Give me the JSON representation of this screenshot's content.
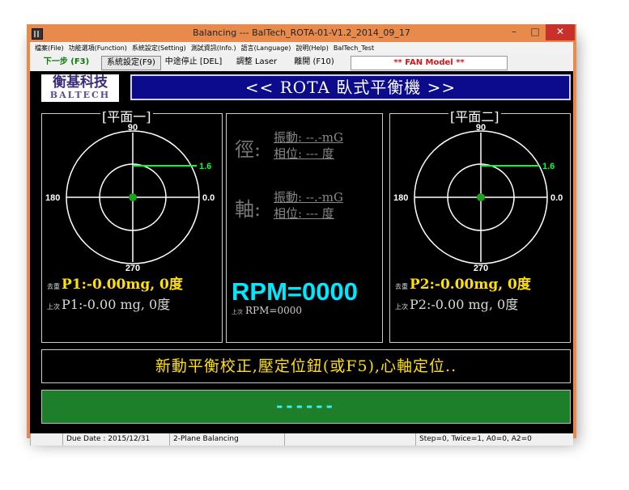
{
  "window": {
    "title": "Balancing --- BalTech_ROTA-01-V1.2_2014_09_17",
    "min_glyph": "–",
    "max_glyph": "□",
    "close_glyph": "✕"
  },
  "menu": {
    "items": [
      "檔案(File)",
      "功能選項(Function)",
      "系統設定(Setting)",
      "測試資訊(Info.)",
      "語言(Language)",
      "說明(Help)",
      "BalTech_Test"
    ]
  },
  "toolbar": {
    "next": "下一步 (F3)",
    "system_setting": "系統設定(F9)",
    "emergency_stop": "中途停止 [DEL]",
    "adjust_laser": "調整  Laser",
    "exit": "離開 (F10)",
    "model": "** FAN Model **"
  },
  "logo": {
    "cn": "衡基科技",
    "en": "BALTECH"
  },
  "banner": "<< ROTA  臥式平衡機  >>",
  "plane1": {
    "title": "[平面一]",
    "angle_top": "90",
    "angle_left": "180",
    "angle_right": "0.0",
    "angle_bottom": "270",
    "scale_label": "1.6",
    "current_tag": "去重",
    "current": "P1:-0.00mg, 0度",
    "prev_tag": "上次",
    "prev": "P1:-0.00 mg, 0度"
  },
  "plane2": {
    "title": "[平面二]",
    "angle_top": "90",
    "angle_left": "180",
    "angle_right": "0.0",
    "angle_bottom": "270",
    "scale_label": "1.6",
    "current_tag": "去重",
    "current": "P2:-0.00mg, 0度",
    "prev_tag": "上次",
    "prev": "P2:-0.00 mg, 0度"
  },
  "center": {
    "radial_label": "徑:",
    "radial_vibration": "振動: --.-mG",
    "radial_phase": "相位: --- 度",
    "axial_label": "軸:",
    "axial_vibration": "振動: --.-mG",
    "axial_phase": "相位: --- 度",
    "rpm": "RPM=0000",
    "prev_tag": "上次",
    "prev_rpm": "RPM=0000"
  },
  "message": "新動平衡校正,壓定位鈕(或F5),心軸定位..",
  "progress_text": "------",
  "status": {
    "due_date": "Due Date : 2015/12/31",
    "mode": "2-Plane Balancing",
    "step_info": "Step=0, Twice=1, A0=0, A2=0"
  },
  "colors": {
    "frame": "#e88a4c",
    "banner": "#0b0b8c",
    "yellow_text": "#ffe000",
    "rpm": "#00e8ff",
    "progress_bg": "#1e7f2a",
    "vector": "#00ff33"
  }
}
